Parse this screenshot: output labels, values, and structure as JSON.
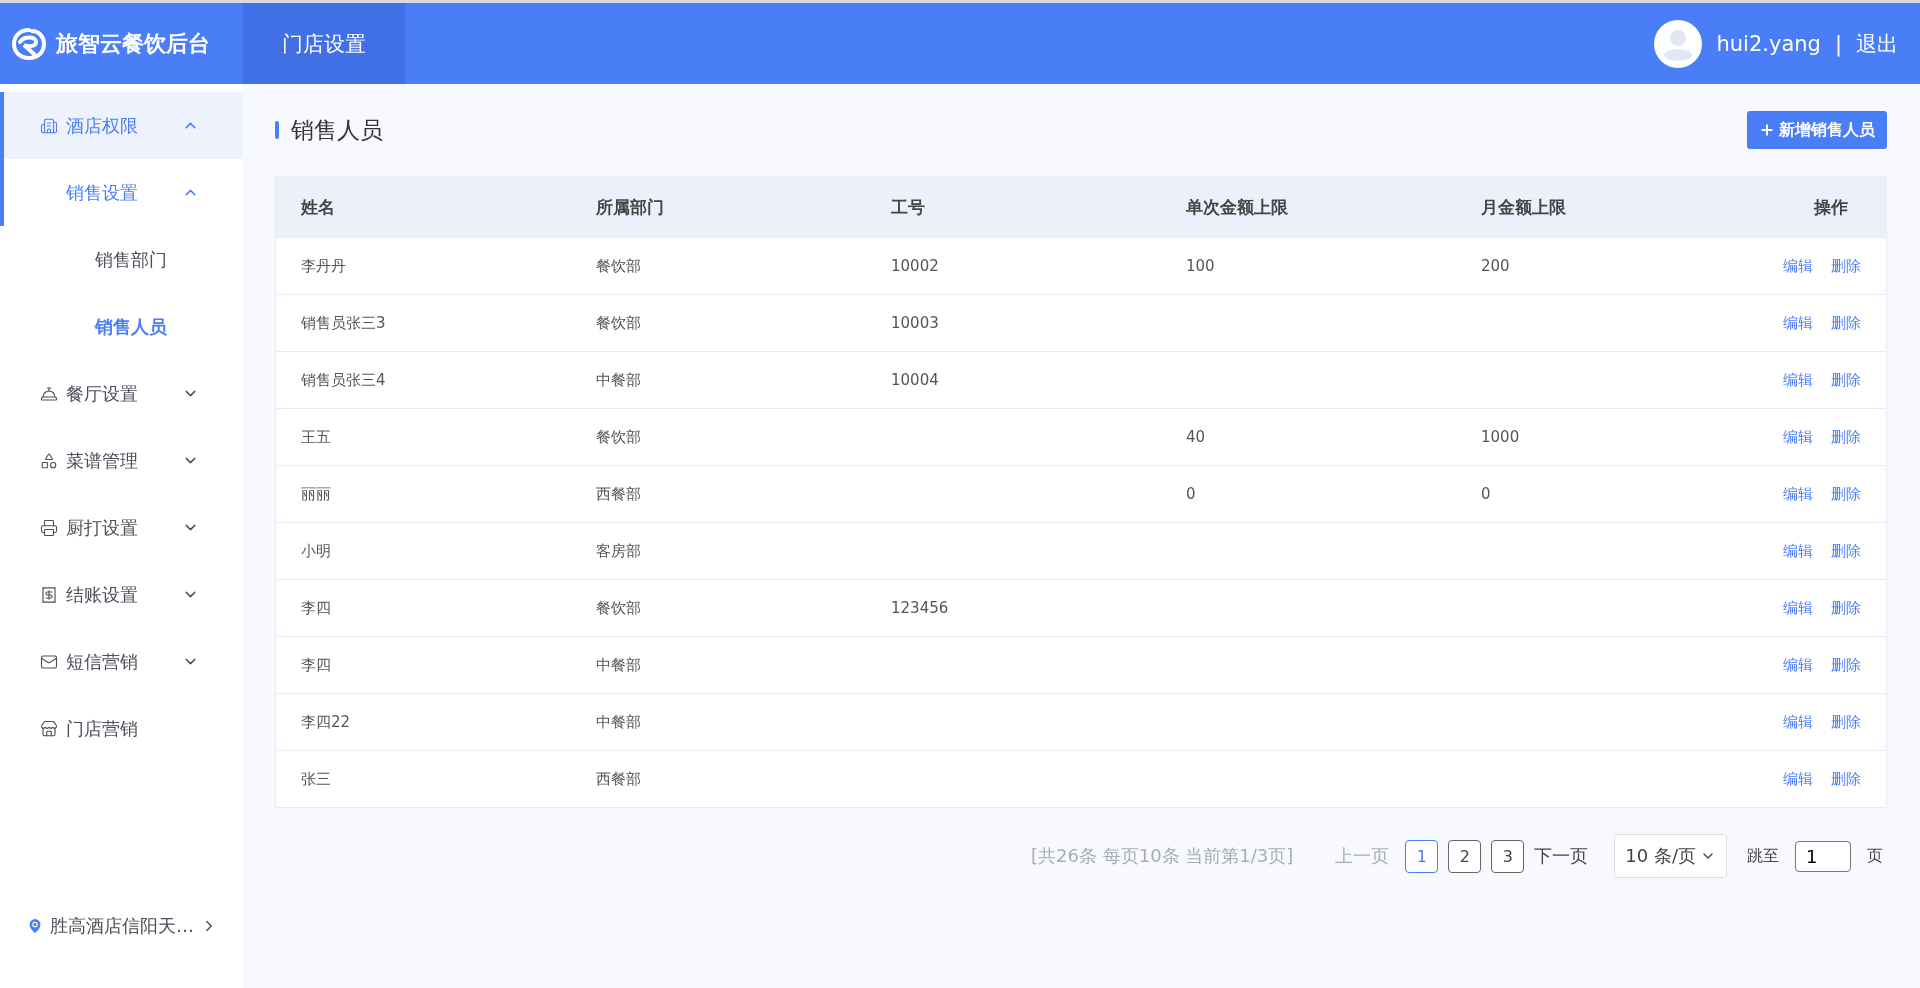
{
  "header": {
    "app_name": "旅智云餐饮后台",
    "nav": [
      {
        "label": "门店设置",
        "selected": true
      }
    ],
    "user": "hui2.yang",
    "separator": "|",
    "logout": "退出"
  },
  "sidebar": {
    "items": [
      {
        "label": "酒店权限",
        "expanded": true,
        "selected": true,
        "children": [
          {
            "label": "销售设置",
            "expanded": true,
            "selected": false,
            "children": [
              {
                "label": "销售部门",
                "selected": false
              },
              {
                "label": "销售人员",
                "selected": true
              }
            ]
          }
        ]
      },
      {
        "label": "餐厅设置",
        "expanded": false,
        "selected": false
      },
      {
        "label": "菜谱管理",
        "expanded": false,
        "selected": false
      },
      {
        "label": "厨打设置",
        "expanded": false,
        "selected": false
      },
      {
        "label": "结账设置",
        "expanded": false,
        "selected": false
      },
      {
        "label": "短信营销",
        "expanded": false,
        "selected": false
      },
      {
        "label": "门店营销",
        "selected": false
      }
    ],
    "location": "胜高酒店信阳天…"
  },
  "page": {
    "title": "销售人员",
    "add_button": "新增销售人员"
  },
  "table": {
    "columns": [
      "姓名",
      "所属部门",
      "工号",
      "单次金额上限",
      "月金额上限",
      "操作"
    ],
    "rows": [
      {
        "cells": [
          "李丹丹",
          "餐饮部",
          "10002",
          "100",
          "200"
        ],
        "actions": [
          "编辑",
          "删除"
        ]
      },
      {
        "cells": [
          "销售员张三3",
          "餐饮部",
          "10003",
          "",
          ""
        ],
        "actions": [
          "编辑",
          "删除"
        ]
      },
      {
        "cells": [
          "销售员张三4",
          "中餐部",
          "10004",
          "",
          ""
        ],
        "actions": [
          "编辑",
          "删除"
        ]
      },
      {
        "cells": [
          "王五",
          "餐饮部",
          "",
          "40",
          "1000"
        ],
        "actions": [
          "编辑",
          "删除"
        ]
      },
      {
        "cells": [
          "丽丽",
          "西餐部",
          "",
          "0",
          "0"
        ],
        "actions": [
          "编辑",
          "删除"
        ]
      },
      {
        "cells": [
          "小明",
          "客房部",
          "",
          "",
          ""
        ],
        "actions": [
          "编辑",
          "删除"
        ]
      },
      {
        "cells": [
          "李四",
          "餐饮部",
          "123456",
          "",
          ""
        ],
        "actions": [
          "编辑",
          "删除"
        ]
      },
      {
        "cells": [
          "李四",
          "中餐部",
          "",
          "",
          ""
        ],
        "actions": [
          "编辑",
          "删除"
        ]
      },
      {
        "cells": [
          "李四22",
          "中餐部",
          "",
          "",
          ""
        ],
        "actions": [
          "编辑",
          "删除"
        ]
      },
      {
        "cells": [
          "张三",
          "西餐部",
          "",
          "",
          ""
        ],
        "actions": [
          "编辑",
          "删除"
        ]
      }
    ]
  },
  "pagination": {
    "summary": "[共26条 每页10条 当前第1/3页]",
    "prev": "上一页",
    "pages": [
      {
        "label": "1",
        "selected": true
      },
      {
        "label": "2",
        "selected": false
      },
      {
        "label": "3",
        "selected": false
      }
    ],
    "next": "下一页",
    "page_size": "10 条/页",
    "jump_label": "跳至",
    "jump_value": "1",
    "page_unit": "页"
  }
}
